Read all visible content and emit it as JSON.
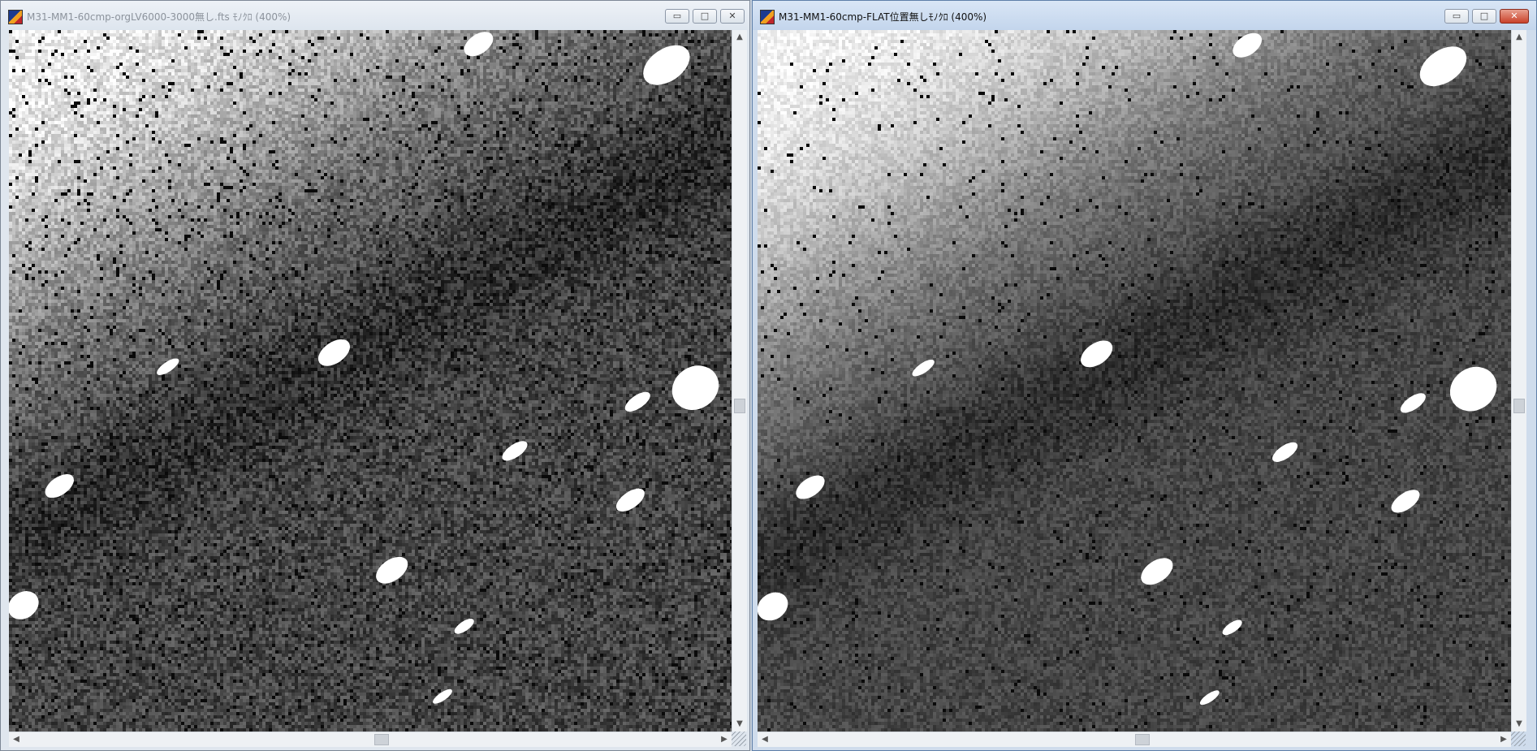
{
  "windows": [
    {
      "id": "left",
      "title": "M31-MM1-60cmp-orgLV6000-3000無し.fts ﾓﾉｸﾛ (400%)",
      "active": false
    },
    {
      "id": "right",
      "title": "M31-MM1-60cmp-FLAT位置無しﾓﾉｸﾛ (400%)",
      "active": true
    }
  ],
  "icons": {
    "minimize": "minimize-icon",
    "maximize": "maximize-icon",
    "close": "close-icon"
  },
  "glyphs": {
    "minimize": "▭",
    "maximize": "□",
    "close": "✕",
    "up": "▲",
    "down": "▼",
    "left": "◀",
    "right": "▶"
  }
}
